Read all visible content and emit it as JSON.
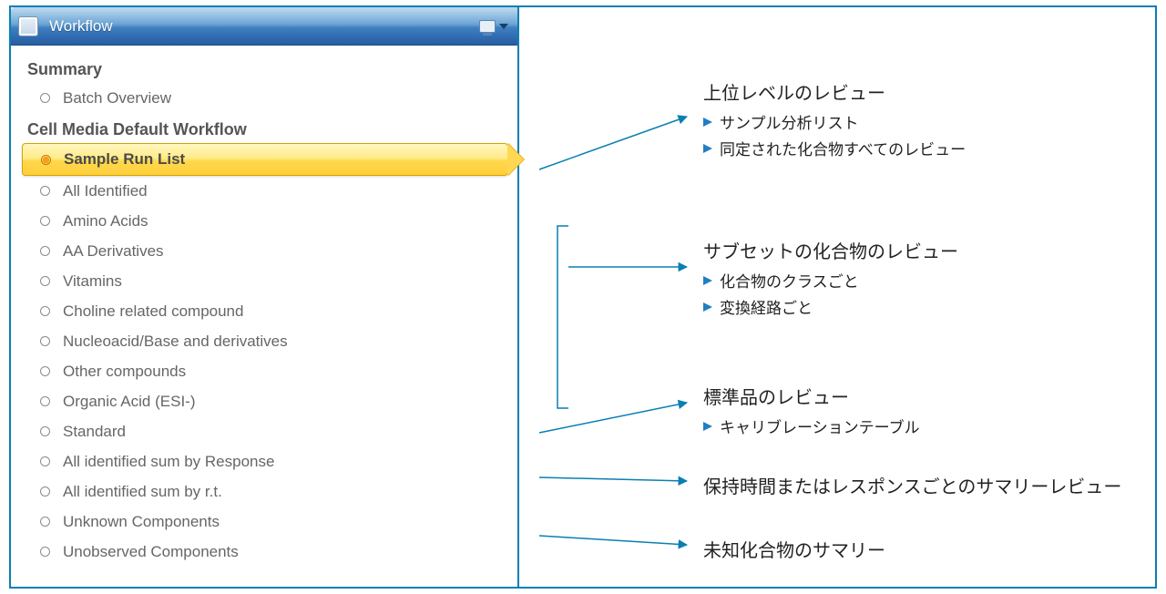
{
  "titlebar": {
    "title": "Workflow"
  },
  "sections": {
    "summary_header": "Summary",
    "workflow_header": "Cell Media Default Workflow"
  },
  "summary_items": [
    {
      "label": "Batch Overview"
    }
  ],
  "workflow_items": [
    {
      "label": "Sample Run List",
      "selected": true
    },
    {
      "label": "All Identified"
    },
    {
      "label": "Amino Acids"
    },
    {
      "label": "AA Derivatives"
    },
    {
      "label": "Vitamins"
    },
    {
      "label": "Choline related compound"
    },
    {
      "label": "Nucleoacid/Base and derivatives"
    },
    {
      "label": "Other compounds"
    },
    {
      "label": "Organic Acid (ESI-)"
    },
    {
      "label": "Standard"
    },
    {
      "label": "All identified sum by Response"
    },
    {
      "label": "All identified sum by r.t."
    },
    {
      "label": "Unknown Components"
    },
    {
      "label": "Unobserved Components"
    }
  ],
  "annotations": {
    "a1": {
      "title": "上位レベルのレビュー",
      "bullets": [
        "サンプル分析リスト",
        "同定された化合物すべてのレビュー"
      ]
    },
    "a2": {
      "title": "サブセットの化合物のレビュー",
      "bullets": [
        "化合物のクラスごと",
        "変換経路ごと"
      ]
    },
    "a3": {
      "title": "標準品のレビュー",
      "bullets": [
        "キャリブレーションテーブル"
      ]
    },
    "a4": {
      "title": "保持時間またはレスポンスごとのサマリーレビュー"
    },
    "a5": {
      "title": "未知化合物のサマリー"
    }
  }
}
